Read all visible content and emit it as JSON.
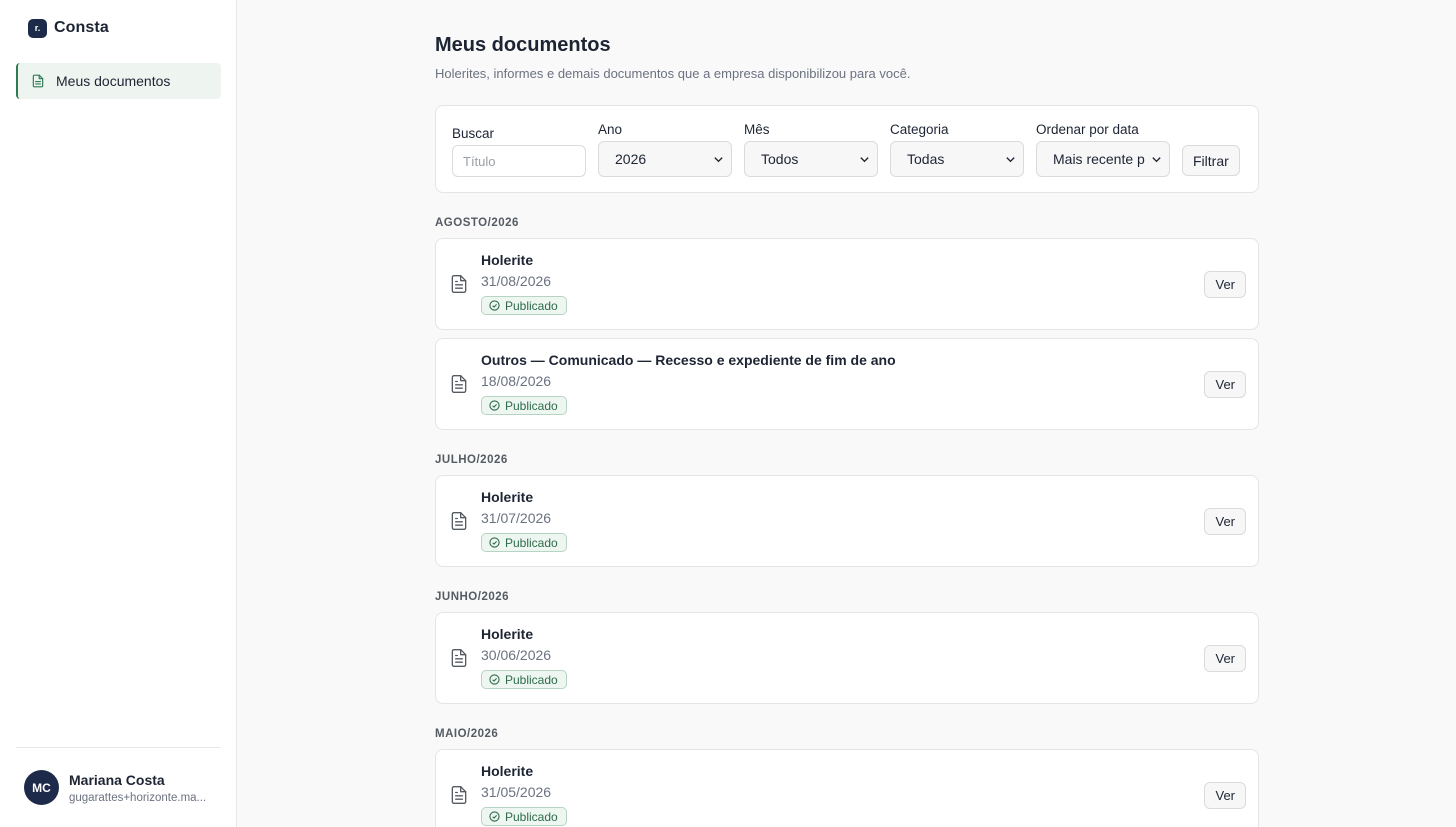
{
  "brand": {
    "name": "Consta",
    "logo_glyph": "r."
  },
  "sidebar": {
    "items": [
      {
        "label": "Meus documentos",
        "icon": "document-icon",
        "active": true
      }
    ]
  },
  "user": {
    "initials": "MC",
    "name": "Mariana Costa",
    "email": "gugarattes+horizonte.ma..."
  },
  "page": {
    "title": "Meus documentos",
    "subtitle": "Holerites, informes e demais documentos que a empresa disponibilizou para você."
  },
  "filters": {
    "search": {
      "label": "Buscar",
      "placeholder": "Título",
      "value": ""
    },
    "year": {
      "label": "Ano",
      "value": "2026"
    },
    "month": {
      "label": "Mês",
      "value": "Todos"
    },
    "category": {
      "label": "Categoria",
      "value": "Todas"
    },
    "order": {
      "label": "Ordenar por data",
      "value": "Mais recente p"
    },
    "submit_label": "Filtrar"
  },
  "groups": [
    {
      "month": "AGOSTO/2026",
      "docs": [
        {
          "title": "Holerite",
          "date": "31/08/2026",
          "status": "Publicado",
          "action": "Ver"
        },
        {
          "title": "Outros — Comunicado — Recesso e expediente de fim de ano",
          "date": "18/08/2026",
          "status": "Publicado",
          "action": "Ver"
        }
      ]
    },
    {
      "month": "JULHO/2026",
      "docs": [
        {
          "title": "Holerite",
          "date": "31/07/2026",
          "status": "Publicado",
          "action": "Ver"
        }
      ]
    },
    {
      "month": "JUNHO/2026",
      "docs": [
        {
          "title": "Holerite",
          "date": "30/06/2026",
          "status": "Publicado",
          "action": "Ver"
        }
      ]
    },
    {
      "month": "MAIO/2026",
      "docs": [
        {
          "title": "Holerite",
          "date": "31/05/2026",
          "status": "Publicado",
          "action": "Ver"
        }
      ]
    }
  ],
  "colors": {
    "accent": "#2f7a55",
    "brand_dark": "#1d2a4a",
    "badge_bg": "#eef6f1"
  }
}
